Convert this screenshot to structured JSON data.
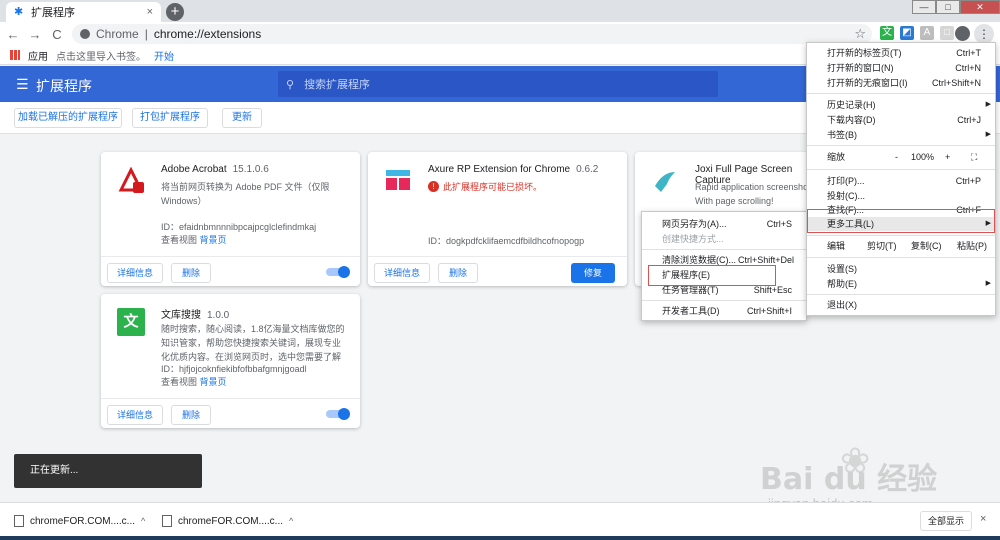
{
  "tab": {
    "title": "扩展程序",
    "close": "×",
    "new_tab": "+"
  },
  "window": {
    "min": "—",
    "max": "□",
    "close": "✕"
  },
  "toolbar": {
    "back": "←",
    "forward": "→",
    "reload": "C",
    "scheme": "Chrome",
    "separator": "|",
    "path": "chrome://extensions",
    "star": "☆",
    "menu": "⋮"
  },
  "bookmarks": {
    "apps": "应用",
    "hint": "点击这里导入书签。",
    "import": "开始"
  },
  "header": {
    "title": "扩展程序",
    "search_placeholder": "搜索扩展程序"
  },
  "actions": {
    "load_unpacked": "加载已解压的扩展程序",
    "pack": "打包扩展程序",
    "update": "更新"
  },
  "cards": [
    {
      "name": "Adobe Acrobat",
      "version": "15.1.0.6",
      "desc": "将当前网页转换为 Adobe PDF 文件（仅限 Windows）",
      "id": "ID：efaidnbmnnnibpcajpcglclefindmkaj",
      "views_label": "查看视图",
      "view_link": "背景页",
      "details": "详细信息",
      "remove": "删除"
    },
    {
      "name": "Axure RP Extension for Chrome",
      "version": "0.6.2",
      "warning": "此扩展程序可能已损坏。",
      "id": "ID：dogkpdfcklifaemcdfbildhcofnopogp",
      "details": "详细信息",
      "remove": "删除",
      "repair": "修复"
    },
    {
      "name": "Joxi Full Page Screen Capture",
      "desc1": "Rapid application screenshots",
      "desc2": "With page scrolling!"
    },
    {
      "name": "文库搜搜",
      "version": "1.0.0",
      "desc": "随时搜索，随心阅读，1.8亿海量文档库做您的知识管家，帮助您快捷搜索关键词，展现专业化优质内容。在浏览网页时，选中您需要了解的内容，选",
      "id": "ID：hjfjojcoknfiekibfofbbafgmnjgoadl",
      "views_label": "查看视图",
      "view_link": "背景页",
      "details": "详细信息",
      "remove": "删除"
    }
  ],
  "menu": {
    "new_tab": "打开新的标签页(T)",
    "new_tab_sc": "Ctrl+T",
    "new_window": "打开新的窗口(N)",
    "new_window_sc": "Ctrl+N",
    "incognito": "打开新的无痕窗口(I)",
    "incognito_sc": "Ctrl+Shift+N",
    "history": "历史记录(H)",
    "downloads": "下载内容(D)",
    "downloads_sc": "Ctrl+J",
    "bookmarks": "书签(B)",
    "zoom": "缩放",
    "zoom_minus": "-",
    "zoom_value": "100%",
    "zoom_plus": "+",
    "fullscreen": "⛶",
    "print": "打印(P)...",
    "print_sc": "Ctrl+P",
    "cast": "投射(C)...",
    "find": "查找(F)...",
    "find_sc": "Ctrl+F",
    "more_tools": "更多工具(L)",
    "edit": "编辑",
    "cut": "剪切(T)",
    "copy": "复制(C)",
    "paste": "粘贴(P)",
    "settings": "设置(S)",
    "help": "帮助(E)",
    "exit": "退出(X)",
    "arrow": "▶"
  },
  "submenu": {
    "save_as": "网页另存为(A)...",
    "save_as_sc": "Ctrl+S",
    "create_shortcut": "创建快捷方式...",
    "clear_data": "清除浏览数据(C)...",
    "clear_data_sc": "Ctrl+Shift+Del",
    "extensions": "扩展程序(E)",
    "task_manager": "任务管理器(T)",
    "task_manager_sc": "Shift+Esc",
    "dev_tools": "开发者工具(D)",
    "dev_tools_sc": "Ctrl+Shift+I"
  },
  "toast": "正在更新...",
  "downloads": {
    "item1": "chromeFOR.COM....c...",
    "item2": "chromeFOR.COM....c...",
    "show_all": "全部显示",
    "close": "×",
    "chevron": "^"
  },
  "watermark": {
    "brand": "Bai du 经验",
    "site": "jingyan.baidu.com"
  }
}
